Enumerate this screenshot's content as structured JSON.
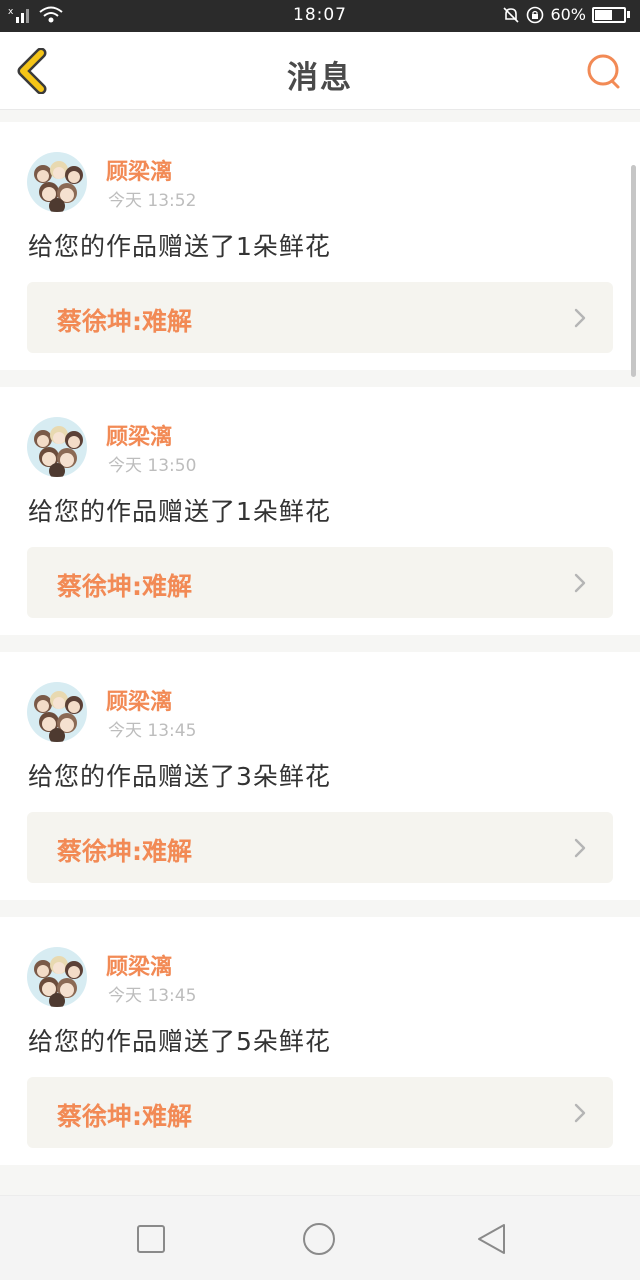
{
  "status_bar": {
    "time": "18:07",
    "battery_text": "60%",
    "battery_level": 0.6
  },
  "header": {
    "title": "消息",
    "back_icon": "chevron-left-icon",
    "search_icon": "search-icon"
  },
  "messages": [
    {
      "sender": "顾梁漓",
      "time": "今天 13:52",
      "text": "给您的作品赠送了1朵鲜花",
      "work": "蔡徐坤:难解"
    },
    {
      "sender": "顾梁漓",
      "time": "今天 13:50",
      "text": "给您的作品赠送了1朵鲜花",
      "work": "蔡徐坤:难解"
    },
    {
      "sender": "顾梁漓",
      "time": "今天 13:45",
      "text": "给您的作品赠送了3朵鲜花",
      "work": "蔡徐坤:难解"
    },
    {
      "sender": "顾梁漓",
      "time": "今天 13:45",
      "text": "给您的作品赠送了5朵鲜花",
      "work": "蔡徐坤:难解"
    }
  ],
  "nav": {
    "recent_icon": "square-icon",
    "home_icon": "circle-icon",
    "back_icon": "triangle-back-icon"
  },
  "colors": {
    "accent": "#f28a55",
    "back_arrow": "#f5c518",
    "status_bar": "#2b2b2b"
  }
}
